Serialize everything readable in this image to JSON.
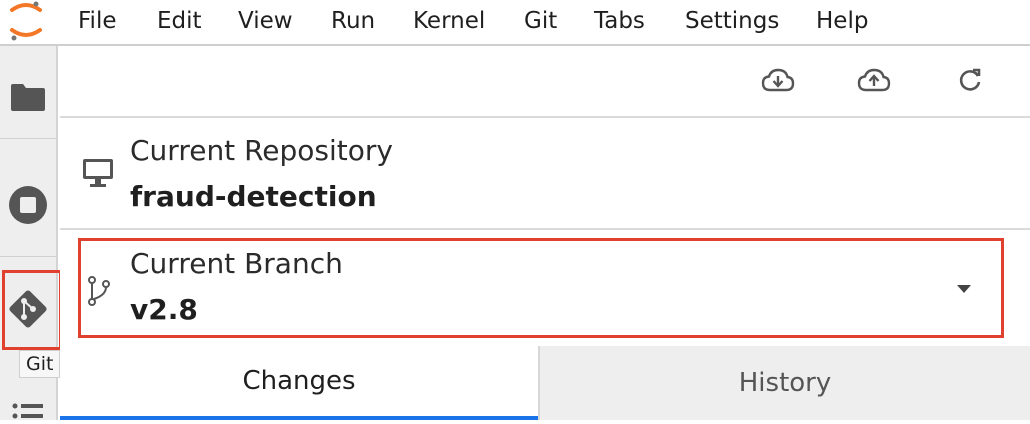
{
  "menubar": {
    "items": [
      "File",
      "Edit",
      "View",
      "Run",
      "Kernel",
      "Git",
      "Tabs",
      "Settings",
      "Help"
    ]
  },
  "sidebar": {
    "items": [
      "folder-icon",
      "stop-circle-icon",
      "git-icon",
      "list-icon"
    ],
    "tooltip": "Git"
  },
  "git_panel": {
    "toolbar": [
      "cloud-download-icon",
      "cloud-upload-icon",
      "refresh-icon"
    ],
    "repository": {
      "label": "Current Repository",
      "value": "fraud-detection"
    },
    "branch": {
      "label": "Current Branch",
      "value": "v2.8"
    },
    "tabs": {
      "changes": "Changes",
      "history": "History"
    }
  },
  "colors": {
    "highlight": "#e0402e",
    "accent_tab": "#1a73e8",
    "logo_orange": "#f37726"
  }
}
